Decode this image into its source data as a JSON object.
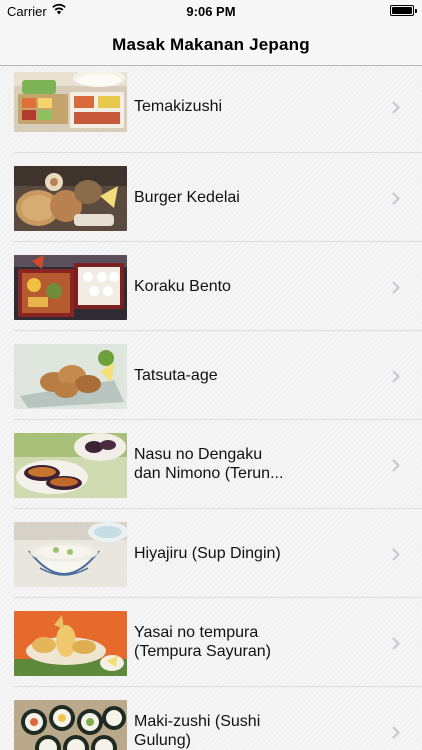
{
  "status_bar": {
    "carrier": "Carrier",
    "time": "9:06 PM",
    "battery_level": 1.0
  },
  "nav": {
    "title": "Masak Makanan Jepang"
  },
  "items": [
    {
      "label": "Temakizushi",
      "icon": "temakizushi-photo"
    },
    {
      "label": "Burger Kedelai",
      "icon": "burger-kedelai-photo"
    },
    {
      "label": "Koraku Bento",
      "icon": "koraku-bento-photo"
    },
    {
      "label": "Tatsuta-age",
      "icon": "tatsuta-age-photo"
    },
    {
      "label": "Nasu no Dengaku\ndan Nimono (Terun...",
      "icon": "nasu-dengaku-photo"
    },
    {
      "label": "Hiyajiru (Sup Dingin)",
      "icon": "hiyajiru-photo"
    },
    {
      "label": "Yasai no tempura\n(Tempura Sayuran)",
      "icon": "yasai-tempura-photo"
    },
    {
      "label": "Maki-zushi (Sushi\nGulung)",
      "icon": "maki-zushi-photo"
    }
  ]
}
